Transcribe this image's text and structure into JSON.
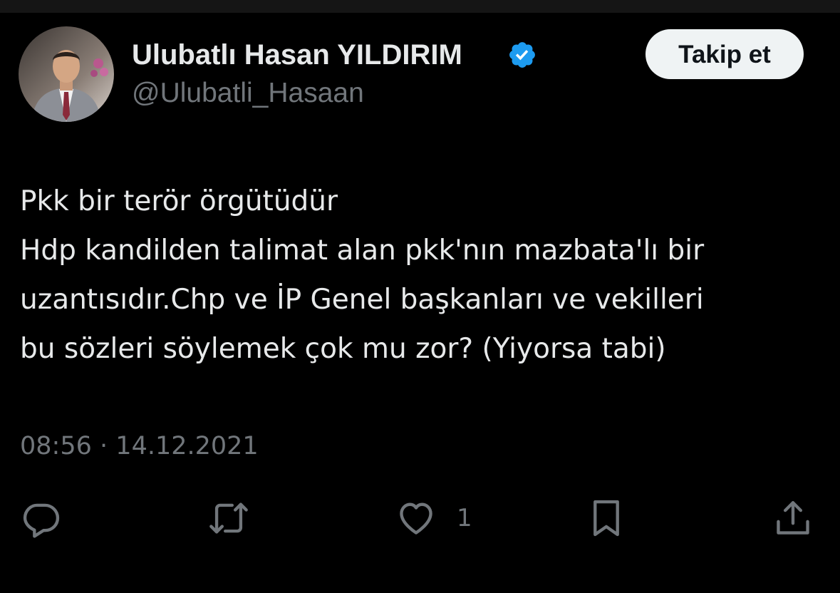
{
  "author": {
    "display_name": "Ulubatlı Hasan YILDIRIM",
    "handle": "@Ulubatli_Hasaan",
    "verified": true,
    "avatar": "profile-photo"
  },
  "follow_button": {
    "label": "Takip et"
  },
  "tweet": {
    "lines": [
      "Pkk bir terör örgütüdür",
      "Hdp kandilden talimat alan pkk'nın mazbata'lı bir",
      "uzantısıdır.Chp ve İP Genel başkanları ve vekilleri",
      "bu sözleri söylemek çok mu zor? (Yiyorsa tabi)"
    ],
    "time": "08:56",
    "separator": "·",
    "date": "14.12.2021"
  },
  "actions": {
    "reply": {
      "icon": "reply-icon"
    },
    "retweet": {
      "icon": "retweet-icon"
    },
    "like": {
      "icon": "heart-icon",
      "count": "1"
    },
    "bookmark": {
      "icon": "bookmark-icon"
    },
    "share": {
      "icon": "share-icon"
    }
  },
  "colors": {
    "background": "#000000",
    "text": "#e7e9ea",
    "secondary_text": "#71767b",
    "verified_badge": "#1d9bf0",
    "follow_button_bg": "#eff3f4"
  }
}
